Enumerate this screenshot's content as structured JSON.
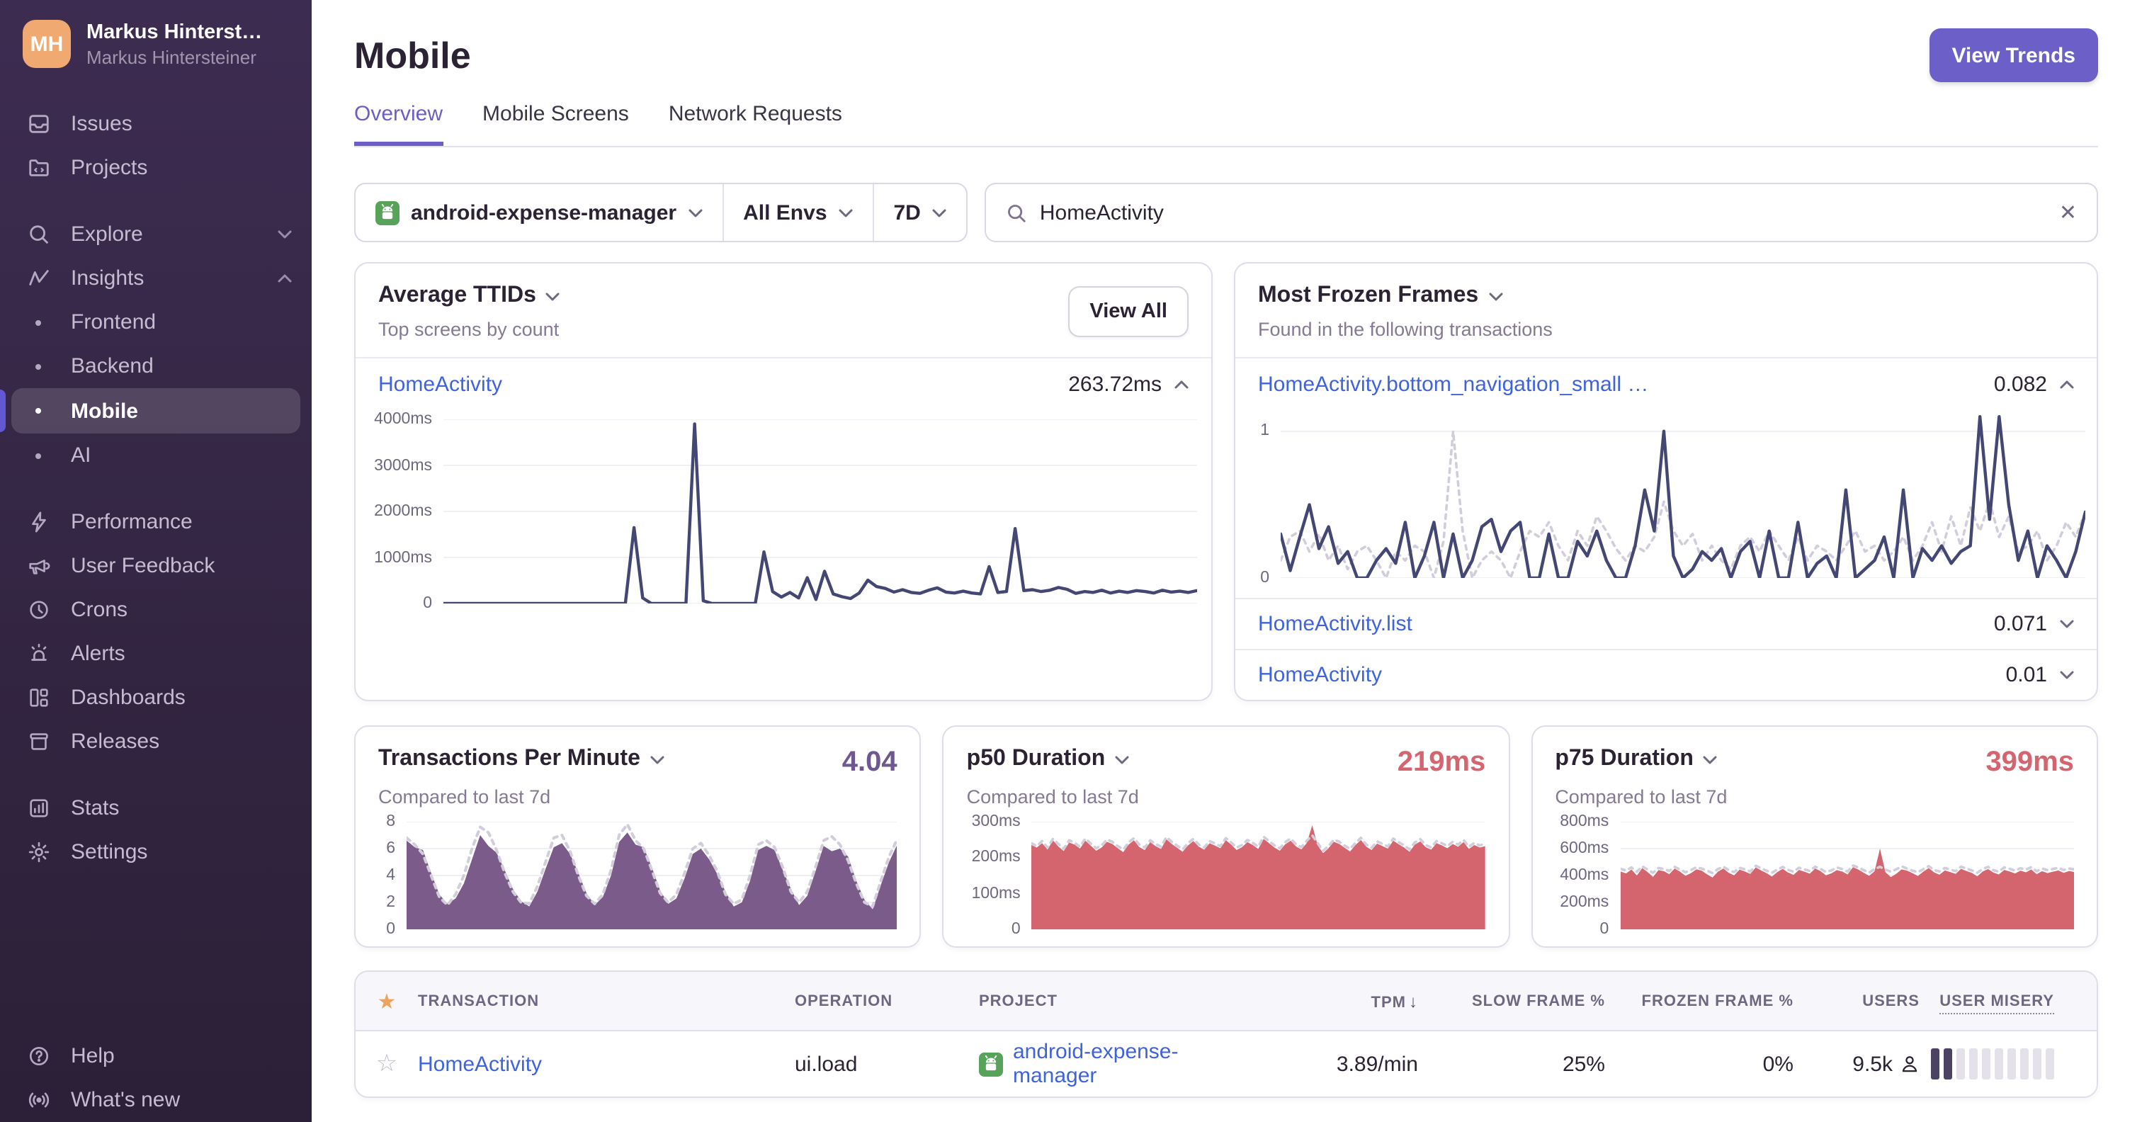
{
  "colors": {
    "accent": "#6c5fc7",
    "link": "#3e63dd",
    "sidebar_top": "#3d2c51",
    "sidebar_bottom": "#2b2037",
    "chart_line": "#444674",
    "chart_purple_fill": "#7a5b8a",
    "chart_red_fill": "#d4656e",
    "chart_prev_dotted": "#d2cdda",
    "tpm_value": "#6f5791",
    "duration_value": "#d4656e",
    "misery_dark": "#4b4266",
    "misery_light": "#e4e1ea",
    "android_green": "#57a35a",
    "avatar_orange": "#efa971"
  },
  "glyphs": {
    "star_filled": "★",
    "star_outline": "☆",
    "sort_desc": "↓",
    "close": "✕"
  },
  "sidebar": {
    "user": {
      "initials": "MH",
      "name": "Markus Hinterst…",
      "org": "Markus Hintersteiner"
    },
    "issues": "Issues",
    "projects": "Projects",
    "explore": "Explore",
    "insights": "Insights",
    "insights_children": [
      {
        "label": "Frontend"
      },
      {
        "label": "Backend"
      },
      {
        "label": "Mobile",
        "active": true
      },
      {
        "label": "AI"
      }
    ],
    "secondary": [
      {
        "label": "Performance"
      },
      {
        "label": "User Feedback"
      },
      {
        "label": "Crons"
      },
      {
        "label": "Alerts"
      },
      {
        "label": "Dashboards"
      },
      {
        "label": "Releases"
      }
    ],
    "tertiary": [
      {
        "label": "Stats"
      },
      {
        "label": "Settings"
      }
    ],
    "footer": [
      {
        "label": "Help"
      },
      {
        "label": "What's new"
      }
    ]
  },
  "header": {
    "title": "Mobile",
    "view_trends_label": "View Trends"
  },
  "tabs": [
    {
      "label": "Overview",
      "active": true
    },
    {
      "label": "Mobile Screens"
    },
    {
      "label": "Network Requests"
    }
  ],
  "filters": {
    "project": "android-expense-manager",
    "environment": "All Envs",
    "period": "7D",
    "search_value": "HomeActivity"
  },
  "cards": {
    "avg_ttids": {
      "title": "Average TTIDs",
      "subtitle": "Top screens by count",
      "view_all_label": "View All",
      "row": {
        "transaction": "HomeActivity",
        "value": "263.72ms",
        "expanded": true
      }
    },
    "frozen": {
      "title": "Most Frozen Frames",
      "subtitle": "Found in the following transactions",
      "rows": [
        {
          "transaction": "HomeActivity.bottom_navigation_small …",
          "value": "0.082",
          "expanded": true
        },
        {
          "transaction": "HomeActivity.list",
          "value": "0.071",
          "expanded": false
        },
        {
          "transaction": "HomeActivity",
          "value": "0.01",
          "expanded": false
        }
      ]
    },
    "tpm": {
      "title": "Transactions Per Minute",
      "value": "4.04",
      "subtitle": "Compared to last 7d",
      "value_color": "#6f5791"
    },
    "p50": {
      "title": "p50 Duration",
      "value": "219ms",
      "subtitle": "Compared to last 7d",
      "value_color": "#d4656e"
    },
    "p75": {
      "title": "p75 Duration",
      "value": "399ms",
      "subtitle": "Compared to last 7d",
      "value_color": "#d4656e"
    }
  },
  "table": {
    "columns": {
      "transaction": "TRANSACTION",
      "operation": "OPERATION",
      "project": "PROJECT",
      "tpm": "TPM",
      "slow": "SLOW FRAME %",
      "frozen": "FROZEN FRAME %",
      "users": "USERS",
      "misery": "USER MISERY"
    },
    "row": {
      "transaction": "HomeActivity",
      "operation": "ui.load",
      "project": "android-expense-manager",
      "tpm": "3.89/min",
      "slow": "25%",
      "frozen": "0%",
      "users": "9.5k",
      "misery_filled": 2,
      "misery_total": 10
    }
  },
  "chart_data": [
    {
      "id": "ttid",
      "type": "line",
      "title": "Average TTIDs — HomeActivity (ms)",
      "ylim": [
        0,
        4000
      ],
      "yticks": [
        {
          "label": "4000ms",
          "value": 4000
        },
        {
          "label": "3000ms",
          "value": 3000
        },
        {
          "label": "2000ms",
          "value": 2000
        },
        {
          "label": "1000ms",
          "value": 1000
        },
        {
          "label": "0",
          "value": 0
        }
      ],
      "series": [
        {
          "name": "TTID",
          "color": "#444674",
          "width": 2.2,
          "values": [
            0,
            0,
            0,
            0,
            0,
            0,
            0,
            0,
            0,
            0,
            0,
            0,
            0,
            0,
            0,
            0,
            0,
            0,
            0,
            0,
            0,
            0,
            1650,
            120,
            0,
            0,
            0,
            0,
            0,
            3900,
            60,
            0,
            0,
            0,
            0,
            0,
            0,
            1120,
            260,
            140,
            240,
            120,
            560,
            90,
            700,
            210,
            150,
            110,
            230,
            510,
            370,
            330,
            250,
            300,
            240,
            220,
            290,
            340,
            250,
            230,
            270,
            230,
            210,
            800,
            240,
            260,
            1630,
            280,
            300,
            260,
            290,
            350,
            310,
            220,
            260,
            240,
            290,
            230,
            270,
            240,
            280,
            260,
            230,
            290,
            250,
            270,
            240,
            280
          ]
        }
      ]
    },
    {
      "id": "frozen",
      "type": "line",
      "title": "Most Frozen Frames — HomeActivity.bottom_navigation_small …",
      "ylim": [
        0,
        1.12
      ],
      "yticks": [
        {
          "label": "1",
          "value": 1
        },
        {
          "label": "0",
          "value": 0
        }
      ],
      "series": [
        {
          "name": "previous period",
          "color": "#d2cdda",
          "width": 1.8,
          "dash": "3 3.5",
          "values": [
            0.12,
            0.28,
            0.32,
            0.18,
            0.3,
            0.12,
            0.22,
            0.06,
            0.18,
            0.22,
            0.12,
            0,
            0.18,
            0.12,
            0.22,
            0.18,
            0,
            0.25,
            1,
            0.32,
            0,
            0.12,
            0.18,
            0.12,
            0,
            0.18,
            0.32,
            0.28,
            0.38,
            0.22,
            0.12,
            0.32,
            0.22,
            0.42,
            0.32,
            0.2,
            0.12,
            0.22,
            0.18,
            0.28,
            0.52,
            0.32,
            0.22,
            0.3,
            0.12,
            0.22,
            0.12,
            0.06,
            0.22,
            0.28,
            0.18,
            0.32,
            0.22,
            0.12,
            0.28,
            0.12,
            0.22,
            0.18,
            0.12,
            0.22,
            0.32,
            0.18,
            0.22,
            0.12,
            0.18,
            0.28,
            0.12,
            0.22,
            0.38,
            0.18,
            0.42,
            0.22,
            0.48,
            0.32,
            0.52,
            0.28,
            0.42,
            0.18,
            0.22,
            0.32,
            0.12,
            0.22,
            0.38,
            0.28,
            0.45
          ]
        },
        {
          "name": "frozen frame rate",
          "color": "#444674",
          "width": 2.2,
          "values": [
            0.3,
            0.05,
            0.28,
            0.5,
            0.2,
            0.35,
            0.1,
            0.18,
            0,
            0,
            0.12,
            0.2,
            0.1,
            0.38,
            0,
            0.15,
            0.38,
            0,
            0.3,
            0,
            0.12,
            0.35,
            0.4,
            0.18,
            0.32,
            0.38,
            0,
            0,
            0.3,
            0,
            0,
            0.25,
            0.15,
            0.32,
            0.12,
            0,
            0,
            0.22,
            0.6,
            0.32,
            1,
            0.15,
            0,
            0.06,
            0.18,
            0.12,
            0.2,
            0,
            0.18,
            0.25,
            0,
            0.32,
            0,
            0,
            0.38,
            0,
            0.1,
            0.15,
            0,
            0.6,
            0,
            0.06,
            0.12,
            0.28,
            0,
            0.6,
            0,
            0.2,
            0.12,
            0.22,
            0.1,
            0.18,
            0.22,
            1.1,
            0.4,
            1.1,
            0.5,
            0.12,
            0.32,
            0,
            0.22,
            0.12,
            0,
            0.18,
            0.45
          ]
        }
      ]
    },
    {
      "id": "tpm",
      "type": "area",
      "title": "Transactions Per Minute",
      "ylim": [
        0,
        8
      ],
      "yticks": [
        {
          "label": "8",
          "value": 8
        },
        {
          "label": "6",
          "value": 6
        },
        {
          "label": "4",
          "value": 4
        },
        {
          "label": "2",
          "value": 2
        },
        {
          "label": "0",
          "value": 0
        }
      ],
      "series": [
        {
          "name": "current",
          "color": "#7a5b8a",
          "fill": true,
          "values": [
            6.6,
            6.1,
            5.9,
            4.2,
            2.6,
            1.9,
            2.3,
            3.4,
            5.2,
            7.0,
            6.2,
            5.7,
            4.4,
            3.0,
            2.1,
            1.7,
            2.8,
            4.5,
            6.1,
            6.4,
            5.6,
            4.2,
            2.7,
            1.8,
            2.4,
            4.0,
            6.5,
            7.2,
            6.3,
            6.1,
            4.6,
            2.9,
            1.9,
            2.3,
            3.8,
            5.6,
            6.0,
            5.2,
            4.1,
            2.8,
            1.7,
            2.0,
            3.6,
            5.9,
            6.2,
            5.9,
            4.4,
            3.0,
            1.8,
            2.5,
            4.3,
            6.2,
            5.8,
            6.0,
            5.4,
            3.6,
            2.2,
            1.5,
            3.3,
            5.0,
            6.3
          ]
        },
        {
          "name": "previous period",
          "color": "#d2cdda",
          "width": 2,
          "dash": "3 3.5",
          "values": [
            6.8,
            6.3,
            5.6,
            4.0,
            2.4,
            1.8,
            2.6,
            4.0,
            6.0,
            7.6,
            7.2,
            5.9,
            4.2,
            2.8,
            2.0,
            1.9,
            3.2,
            5.0,
            6.8,
            7.0,
            5.8,
            4.0,
            2.5,
            1.9,
            2.6,
            4.4,
            7.0,
            7.8,
            6.6,
            6.0,
            4.4,
            2.7,
            2.0,
            2.6,
            4.2,
            6.0,
            6.4,
            5.5,
            4.3,
            2.6,
            1.9,
            2.2,
            4.0,
            6.3,
            6.6,
            6.1,
            4.6,
            2.8,
            2.0,
            2.8,
            4.6,
            6.6,
            6.9,
            6.3,
            5.1,
            3.4,
            2.0,
            1.7,
            3.6,
            5.4,
            6.7
          ]
        }
      ]
    },
    {
      "id": "p50",
      "type": "area",
      "title": "p50 Duration (ms)",
      "ylim": [
        0,
        300
      ],
      "yticks": [
        {
          "label": "300ms",
          "value": 300
        },
        {
          "label": "200ms",
          "value": 200
        },
        {
          "label": "100ms",
          "value": 100
        },
        {
          "label": "0",
          "value": 0
        }
      ],
      "series": [
        {
          "name": "current",
          "color": "#d4656e",
          "fill": true,
          "values": [
            235,
            228,
            240,
            222,
            248,
            231,
            218,
            242,
            236,
            225,
            247,
            233,
            219,
            228,
            244,
            238,
            226,
            215,
            236,
            248,
            229,
            221,
            243,
            232,
            224,
            251,
            238,
            227,
            216,
            234,
            246,
            230,
            222,
            240,
            233,
            226,
            248,
            236,
            221,
            229,
            243,
            235,
            224,
            252,
            240,
            228,
            219,
            237,
            247,
            231,
            223,
            241,
            290,
            234,
            212,
            226,
            244,
            238,
            227,
            217,
            235,
            249,
            230,
            221,
            239,
            232,
            225,
            247,
            237,
            228,
            216,
            236,
            245,
            229,
            222,
            240,
            234,
            226,
            238,
            230,
            243,
            224,
            235,
            228,
            232
          ]
        },
        {
          "name": "previous period",
          "color": "#d2cdda",
          "width": 1.8,
          "dash": "3 3.5",
          "values": [
            240,
            232,
            246,
            228,
            252,
            238,
            224,
            248,
            241,
            230,
            253,
            239,
            226,
            234,
            250,
            244,
            232,
            222,
            242,
            254,
            236,
            228,
            248,
            238,
            230,
            257,
            244,
            233,
            223,
            240,
            252,
            236,
            228,
            246,
            239,
            232,
            254,
            242,
            228,
            235,
            249,
            241,
            230,
            258,
            246,
            234,
            226,
            243,
            253,
            237,
            229,
            247,
            262,
            240,
            219,
            232,
            250,
            244,
            233,
            224,
            241,
            255,
            236,
            227,
            245,
            238,
            231,
            253,
            243,
            234,
            223,
            242,
            251,
            235,
            228,
            246,
            240,
            232,
            244,
            236,
            249,
            230,
            241,
            234,
            238
          ]
        }
      ]
    },
    {
      "id": "p75",
      "type": "area",
      "title": "p75 Duration (ms)",
      "ylim": [
        0,
        800
      ],
      "yticks": [
        {
          "label": "800ms",
          "value": 800
        },
        {
          "label": "600ms",
          "value": 600
        },
        {
          "label": "400ms",
          "value": 400
        },
        {
          "label": "200ms",
          "value": 200
        },
        {
          "label": "0",
          "value": 0
        }
      ],
      "series": [
        {
          "name": "current",
          "color": "#d4656e",
          "fill": true,
          "values": [
            430,
            415,
            445,
            400,
            455,
            425,
            390,
            440,
            432,
            410,
            452,
            428,
            398,
            418,
            446,
            436,
            408,
            385,
            428,
            452,
            420,
            402,
            444,
            430,
            412,
            460,
            438,
            418,
            392,
            426,
            450,
            422,
            405,
            442,
            428,
            414,
            452,
            432,
            402,
            416,
            440,
            430,
            408,
            462,
            444,
            420,
            398,
            432,
            600,
            426,
            388,
            412,
            446,
            436,
            418,
            396,
            428,
            455,
            424,
            406,
            438,
            426,
            412,
            450,
            434,
            420,
            394,
            430,
            448,
            422,
            408,
            442,
            430,
            415,
            436,
            424,
            445,
            410,
            432,
            418,
            428,
            438,
            420,
            434,
            426
          ]
        },
        {
          "name": "previous period",
          "color": "#d2cdda",
          "width": 1.8,
          "dash": "3 3.5",
          "values": [
            450,
            436,
            460,
            428,
            468,
            444,
            420,
            456,
            448,
            434,
            464,
            446,
            424,
            440,
            462,
            452,
            436,
            418,
            448,
            466,
            440,
            426,
            458,
            446,
            430,
            472,
            454,
            436,
            420,
            444,
            464,
            442,
            428,
            458,
            446,
            434,
            466,
            450,
            426,
            438,
            460,
            448,
            430,
            474,
            460,
            440,
            422,
            448,
            465,
            444,
            428,
            446,
            468,
            452,
            436,
            424,
            446,
            470,
            442,
            430,
            456,
            444,
            432,
            466,
            452,
            438,
            420,
            448,
            464,
            440,
            428,
            460,
            450,
            436,
            454,
            444,
            462,
            432,
            452,
            440,
            448,
            458,
            441,
            452,
            446
          ]
        }
      ]
    }
  ]
}
